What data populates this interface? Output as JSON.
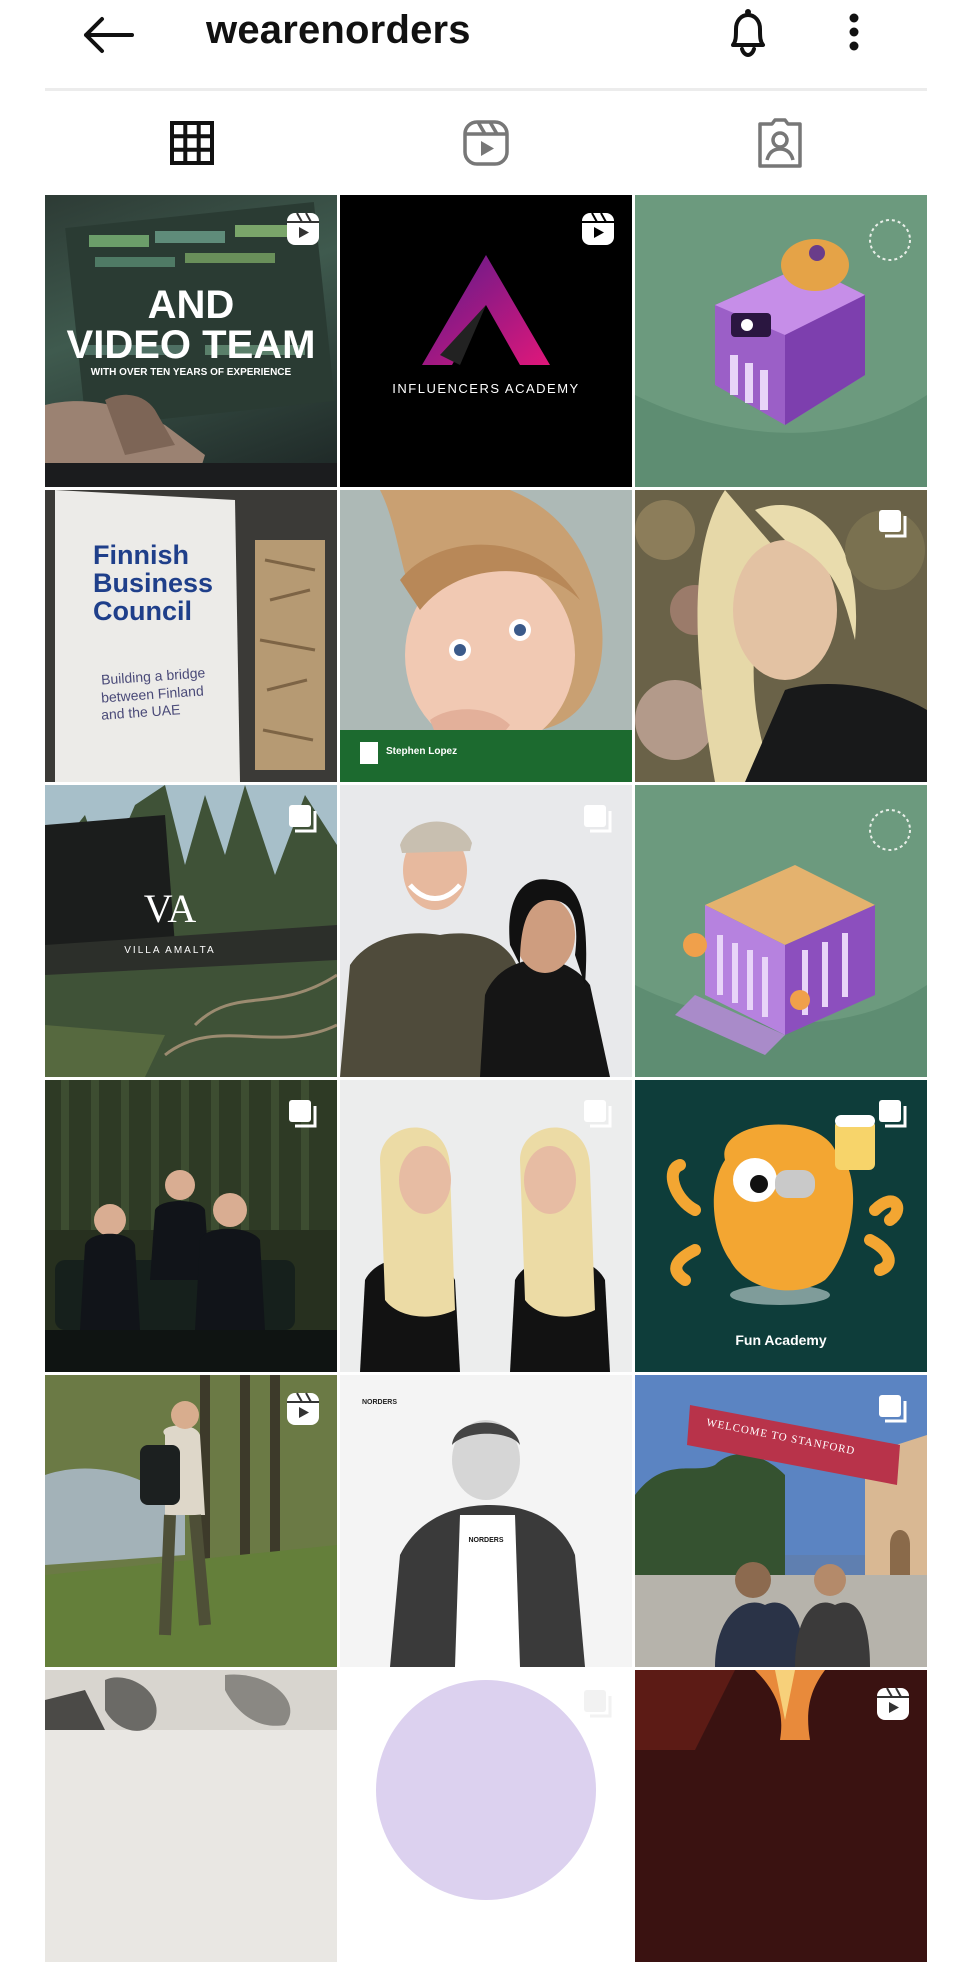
{
  "header": {
    "username": "wearenorders"
  },
  "icons": {
    "back": "arrow-left-icon",
    "bell": "bell-icon",
    "more": "more-vertical-icon"
  },
  "tabs": [
    {
      "name": "grid-posts-tab",
      "icon": "grid-icon",
      "active": true
    },
    {
      "name": "reels-tab",
      "icon": "reels-icon",
      "active": false
    },
    {
      "name": "tagged-tab",
      "icon": "tagged-person-icon",
      "active": false
    }
  ],
  "posts": {
    "p1": {
      "line1": "AND",
      "line2": "VIDEO TEAM",
      "line3": "WITH OVER TEN YEARS OF EXPERIENCE",
      "badge": "reels-icon"
    },
    "p2": {
      "caption": "INFLUENCERS ACADEMY",
      "badge": "reels-icon"
    },
    "p3": {
      "badge": "none"
    },
    "p4": {
      "title1": "Finnish",
      "title2": "Business",
      "title3": "Council",
      "sub1": "Building a bridge",
      "sub2": "between Finland",
      "sub3": "and the UAE"
    },
    "p5": {
      "banner": "Stephen Lopez",
      "badge": "none"
    },
    "p6": {
      "badge": "multiple-icon"
    },
    "p7": {
      "logo": "VA",
      "brand": "VILLA AMALTA",
      "badge": "multiple-icon"
    },
    "p8": {
      "badge": "multiple-icon"
    },
    "p9": {
      "badge": "none"
    },
    "p10": {
      "badge": "multiple-icon"
    },
    "p11": {
      "badge": "multiple-icon"
    },
    "p12": {
      "brand": "Fun Academy",
      "badge": "multiple-icon"
    },
    "p13": {
      "badge": "reels-icon"
    },
    "p14": {
      "tag": "NORDERS",
      "shirt": "NORDERS",
      "badge": "none"
    },
    "p15": {
      "banner": "WELCOME TO STANFORD",
      "badge": "multiple-icon"
    },
    "p16": {
      "badge": "none"
    },
    "p17": {
      "badge": "multiple-icon"
    },
    "p18": {
      "badge": "reels-icon"
    }
  }
}
